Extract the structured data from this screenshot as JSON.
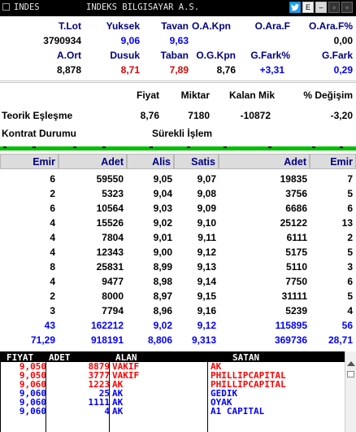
{
  "window": {
    "code": "INDES",
    "name": "INDEKS BILGISAYAR A.S.",
    "btn_e": "E",
    "btn_min": "–",
    "btn_max": "▫",
    "btn_close": "▫"
  },
  "summary": {
    "row1_headers": [
      "T.Lot",
      "Yuksek",
      "Tavan",
      "O.A.Kpn",
      "O.Ara.F",
      "O.Ara.F%"
    ],
    "row1_values": [
      "3790934",
      "9,06",
      "9,63",
      "",
      "",
      "0,00"
    ],
    "row2_headers": [
      "A.Ort",
      "Dusuk",
      "Taban",
      "O.G.Kpn",
      "G.Fark%",
      "G.Fark"
    ],
    "row2_values": [
      "8,878",
      "8,71",
      "7,89",
      "8,76",
      "+3,31",
      "0,29"
    ]
  },
  "theoretical": {
    "headers": [
      "Fiyat",
      "Miktar",
      "Kalan Mik",
      "% Değişim"
    ],
    "label": "Teorik Eşleşme",
    "fiyat": "8,76",
    "miktar": "7180",
    "kalan": "-10872",
    "degisim": "-3,20",
    "contract_label": "Kontrat Durumu",
    "contract_value": "Sürekli İşlem"
  },
  "orderbook": {
    "headers": [
      "Emir",
      "Adet",
      "Alis",
      "Satis",
      "Adet",
      "Emir"
    ],
    "rows": [
      [
        "6",
        "59550",
        "9,05",
        "9,07",
        "19835",
        "7"
      ],
      [
        "2",
        "5323",
        "9,04",
        "9,08",
        "3756",
        "5"
      ],
      [
        "6",
        "10564",
        "9,03",
        "9,09",
        "6686",
        "6"
      ],
      [
        "4",
        "15526",
        "9,02",
        "9,10",
        "25122",
        "13"
      ],
      [
        "4",
        "7804",
        "9,01",
        "9,11",
        "6111",
        "2"
      ],
      [
        "4",
        "12343",
        "9,00",
        "9,12",
        "5175",
        "5"
      ],
      [
        "8",
        "25831",
        "8,99",
        "9,13",
        "5110",
        "3"
      ],
      [
        "4",
        "9477",
        "8,98",
        "9,14",
        "7750",
        "6"
      ],
      [
        "2",
        "8000",
        "8,97",
        "9,15",
        "31111",
        "5"
      ],
      [
        "3",
        "7794",
        "8,96",
        "9,16",
        "5239",
        "4"
      ]
    ],
    "total_row": [
      "43",
      "162212",
      "9,02",
      "9,12",
      "115895",
      "56"
    ],
    "avg_row": [
      "71,29",
      "918191",
      "8,806",
      "9,313",
      "369736",
      "28,71"
    ]
  },
  "trades": {
    "headers": [
      "FIYAT",
      "ADET",
      "ALAN",
      "SATAN"
    ],
    "rows": [
      [
        "9,050",
        "8879",
        "VAKIF",
        "AK"
      ],
      [
        "9,050",
        "3777",
        "VAKIF",
        "PHILLIPCAPITAL"
      ],
      [
        "9,060",
        "1223",
        "AK",
        "PHILLIPCAPITAL"
      ],
      [
        "9,060",
        "25",
        "AK",
        "GEDIK"
      ],
      [
        "9,060",
        "1111",
        "AK",
        "OYAK"
      ],
      [
        "9,060",
        "4",
        "AK",
        "A1 CAPITAL"
      ]
    ]
  },
  "colors": {
    "header_text": "#000080",
    "value_blue": "#0000ff",
    "value_red": "#e00000",
    "green_bar": "#00c000"
  }
}
